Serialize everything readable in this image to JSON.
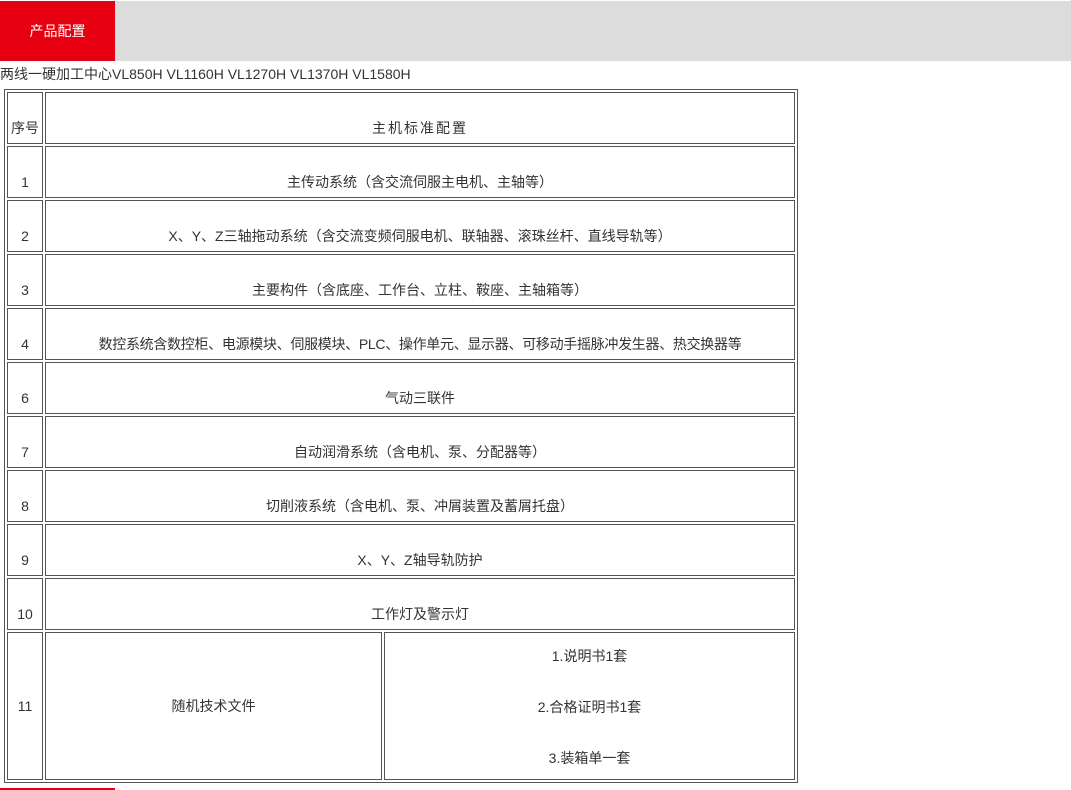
{
  "tab": {
    "active_label": "产品配置"
  },
  "subtitle": "两线一硬加工中心VL850H VL1160H VL1270H VL1370H VL1580H",
  "table": {
    "header": {
      "index": "序号",
      "title": "主机标准配置"
    },
    "rows": [
      {
        "index": "1",
        "text": "主传动系统（含交流伺服主电机、主轴等）"
      },
      {
        "index": "2",
        "text": "X、Y、Z三轴拖动系统（含交流变频伺服电机、联轴器、滚珠丝杆、直线导轨等）"
      },
      {
        "index": "3",
        "text": "主要构件（含底座、工作台、立柱、鞍座、主轴箱等）"
      },
      {
        "index": "4",
        "text": "数控系统含数控柜、电源模块、伺服模块、PLC、操作单元、显示器、可移动手摇脉冲发生器、热交换器等"
      },
      {
        "index": "6",
        "text": "气动三联件"
      },
      {
        "index": "7",
        "text": "自动润滑系统（含电机、泵、分配器等）"
      },
      {
        "index": "8",
        "text": "切削液系统（含电机、泵、冲屑装置及蓄屑托盘）"
      },
      {
        "index": "9",
        "text": "X、Y、Z轴导轨防护"
      },
      {
        "index": "10",
        "text": "工作灯及警示灯"
      }
    ],
    "last": {
      "index": "11",
      "label": "随机技术文件",
      "items": [
        "1.说明书1套",
        "2.合格证明书1套",
        "3.装箱单一套"
      ]
    }
  },
  "colors": {
    "accent": "#e60012",
    "tabbar_bg": "#dcdcdc",
    "border": "#555555"
  }
}
